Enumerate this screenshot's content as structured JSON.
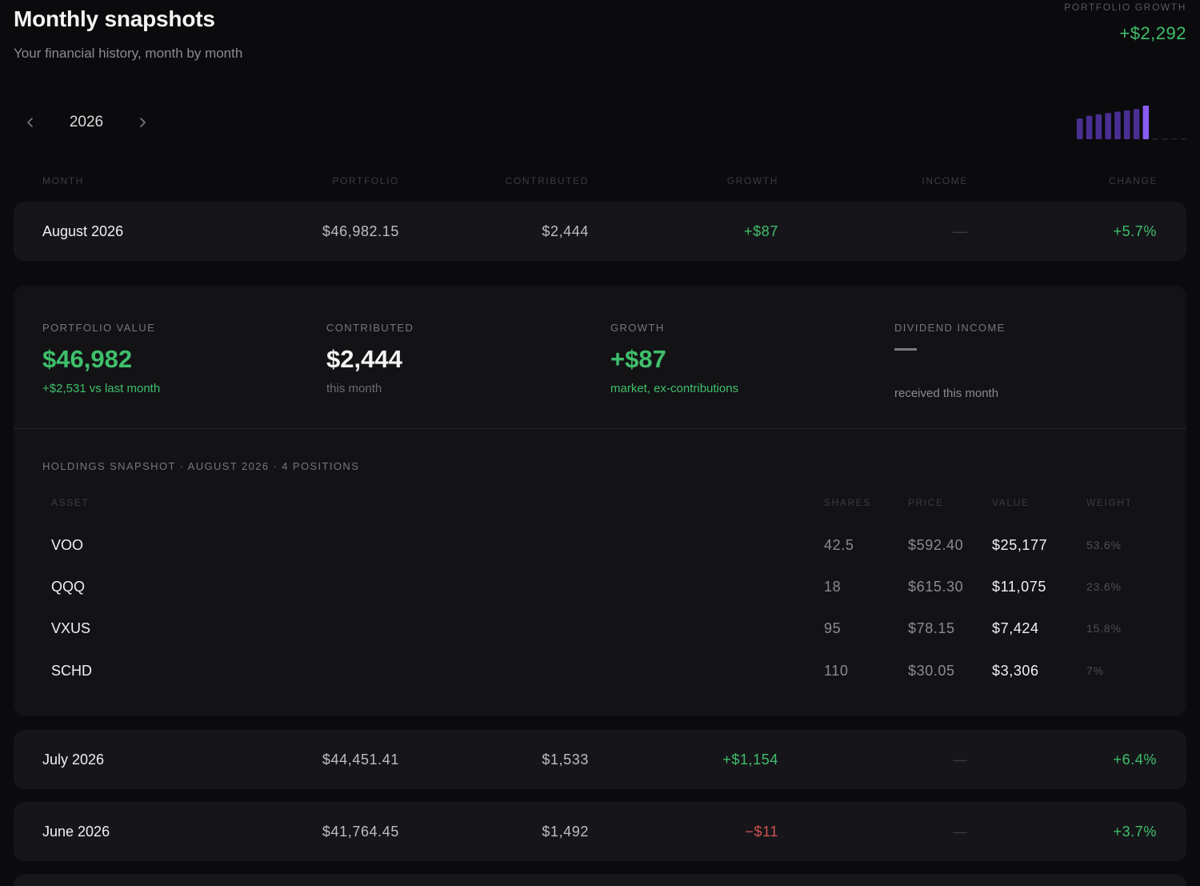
{
  "header": {
    "title": "Monthly snapshots",
    "subtitle": "Your financial history, month by month",
    "growth_label": "PORTFOLIO GROWTH",
    "growth_value": "+$2,292"
  },
  "year_nav": {
    "year": "2026",
    "prev_icon": "chevron-left-icon",
    "next_icon": "chevron-right-icon"
  },
  "spark_bars": {
    "values": [
      0.62,
      0.7,
      0.74,
      0.78,
      0.82,
      0.86,
      0.9,
      1.0
    ],
    "empty_months": 4,
    "bar_color": "#4a2f93",
    "active_color": "#8a5cf6"
  },
  "columns": {
    "month": "MONTH",
    "portfolio": "PORTFOLIO",
    "contributed": "CONTRIBUTED",
    "growth": "GROWTH",
    "income": "INCOME",
    "change": "CHANGE"
  },
  "months": [
    {
      "name": "August 2026",
      "portfolio": "$46,982.15",
      "contributed": "$2,444",
      "growth": "+$87",
      "growth_sign": "pos",
      "income": "—",
      "change": "+5.7%"
    },
    {
      "name": "July 2026",
      "portfolio": "$44,451.41",
      "contributed": "$1,533",
      "growth": "+$1,154",
      "growth_sign": "pos",
      "income": "—",
      "change": "+6.4%"
    },
    {
      "name": "June 2026",
      "portfolio": "$41,764.45",
      "contributed": "$1,492",
      "growth": "−$11",
      "growth_sign": "neg",
      "income": "—",
      "change": "+3.7%"
    }
  ],
  "detail": {
    "stats": [
      {
        "label": "PORTFOLIO VALUE",
        "value": "$46,982",
        "sub": "+$2,531 vs last month",
        "value_color": "#3fbf6b",
        "sub_color": "#3fbf6b"
      },
      {
        "label": "CONTRIBUTED",
        "value": "$2,444",
        "sub": "this month",
        "value_color": "#f4f4f5",
        "sub_color": "#6a6a70"
      },
      {
        "label": "GROWTH",
        "value": "+$87",
        "sub": "market, ex-contributions",
        "value_color": "#3fbf6b",
        "sub_color": "#3fbf6b"
      },
      {
        "label": "DIVIDEND INCOME",
        "value": "—",
        "sub": "received this month",
        "value_color": "#7a7a80",
        "sub_color": "#8b8b90"
      }
    ],
    "holdings_title": "HOLDINGS SNAPSHOT · AUGUST 2026 · 4 POSITIONS",
    "holdings_columns": {
      "asset": "ASSET",
      "shares": "SHARES",
      "price": "PRICE",
      "value": "VALUE",
      "weight": "WEIGHT"
    },
    "holdings": [
      {
        "asset": "VOO",
        "shares": "42.5",
        "price": "$592.40",
        "value": "$25,177",
        "weight": "53.6%"
      },
      {
        "asset": "QQQ",
        "shares": "18",
        "price": "$615.30",
        "value": "$11,075",
        "weight": "23.6%"
      },
      {
        "asset": "VXUS",
        "shares": "95",
        "price": "$78.15",
        "value": "$7,424",
        "weight": "15.8%"
      },
      {
        "asset": "SCHD",
        "shares": "110",
        "price": "$30.05",
        "value": "$3,306",
        "weight": "7%"
      }
    ]
  }
}
